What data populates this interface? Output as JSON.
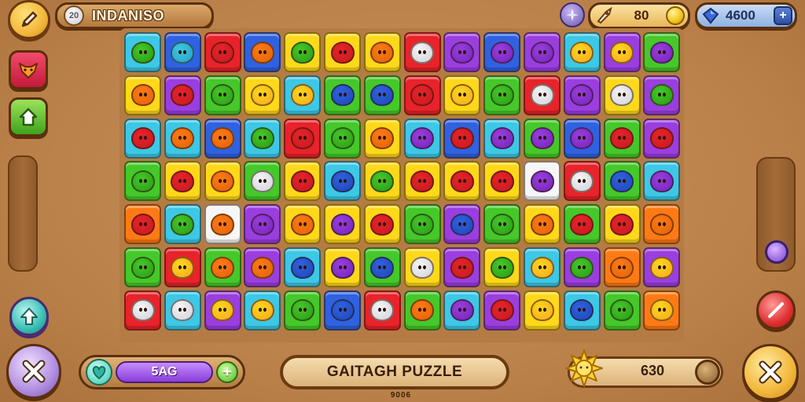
{
  "top_bar": {
    "player_name": "INDANISO",
    "avatar_text": "20",
    "coins": "80",
    "gems": "4600",
    "gem_plus": "+"
  },
  "bottom_bar": {
    "lives_value": "5AG",
    "lives_plus": "+",
    "title": "GAITAGH PUZZLE",
    "subtitle": "9006",
    "score": "630"
  },
  "colors": {
    "red": "#e8232a",
    "orange": "#ff7a14",
    "yellow": "#ffd81a",
    "green": "#45c82a",
    "cyan": "#3cc8e6",
    "blue": "#2f62e0",
    "purple": "#9a3ee0",
    "white": "#f6f6f6"
  },
  "board": {
    "rows": 7,
    "cols": 14,
    "tiles": [
      [
        "cyan",
        "blue",
        "red",
        "blue",
        "yellow",
        "yellow",
        "yellow",
        "red",
        "purple",
        "blue",
        "purple",
        "cyan",
        "purple",
        "green"
      ],
      [
        "yellow",
        "purple",
        "green",
        "yellow",
        "cyan",
        "green",
        "green",
        "red",
        "yellow",
        "green",
        "red",
        "purple",
        "yellow",
        "purple"
      ],
      [
        "cyan",
        "cyan",
        "blue",
        "cyan",
        "red",
        "green",
        "yellow",
        "cyan",
        "blue",
        "cyan",
        "green",
        "blue",
        "green",
        "purple"
      ],
      [
        "green",
        "yellow",
        "yellow",
        "green",
        "yellow",
        "cyan",
        "yellow",
        "yellow",
        "yellow",
        "yellow",
        "white",
        "red",
        "green",
        "cyan"
      ],
      [
        "orange",
        "cyan",
        "white",
        "purple",
        "yellow",
        "yellow",
        "yellow",
        "green",
        "purple",
        "green",
        "yellow",
        "green",
        "yellow",
        "orange"
      ],
      [
        "green",
        "red",
        "green",
        "purple",
        "cyan",
        "yellow",
        "green",
        "yellow",
        "purple",
        "yellow",
        "cyan",
        "purple",
        "orange",
        "purple"
      ],
      [
        "red",
        "cyan",
        "purple",
        "cyan",
        "green",
        "blue",
        "red",
        "green",
        "cyan",
        "purple",
        "yellow",
        "cyan",
        "green",
        "orange"
      ]
    ],
    "creatures": [
      [
        "green",
        "cyan",
        "red",
        "orange",
        "green",
        "red",
        "orange",
        "white",
        "purple",
        "purple",
        "purple",
        "yellow",
        "yellow",
        "purple"
      ],
      [
        "orange",
        "red",
        "green",
        "yellow",
        "yellow",
        "blue",
        "blue",
        "red",
        "yellow",
        "green",
        "white",
        "purple",
        "white",
        "green"
      ],
      [
        "red",
        "orange",
        "orange",
        "green",
        "red",
        "green",
        "orange",
        "purple",
        "red",
        "purple",
        "purple",
        "purple",
        "red",
        "red"
      ],
      [
        "green",
        "red",
        "orange",
        "white",
        "red",
        "blue",
        "green",
        "red",
        "red",
        "red",
        "purple",
        "white",
        "blue",
        "purple"
      ],
      [
        "red",
        "green",
        "orange",
        "purple",
        "orange",
        "purple",
        "red",
        "green",
        "blue",
        "green",
        "orange",
        "red",
        "red",
        "orange"
      ],
      [
        "green",
        "yellow",
        "orange",
        "orange",
        "blue",
        "purple",
        "blue",
        "white",
        "red",
        "green",
        "yellow",
        "green",
        "orange",
        "yellow"
      ],
      [
        "white",
        "white",
        "yellow",
        "yellow",
        "green",
        "blue",
        "white",
        "orange",
        "purple",
        "red",
        "yellow",
        "blue",
        "green",
        "yellow"
      ]
    ]
  }
}
